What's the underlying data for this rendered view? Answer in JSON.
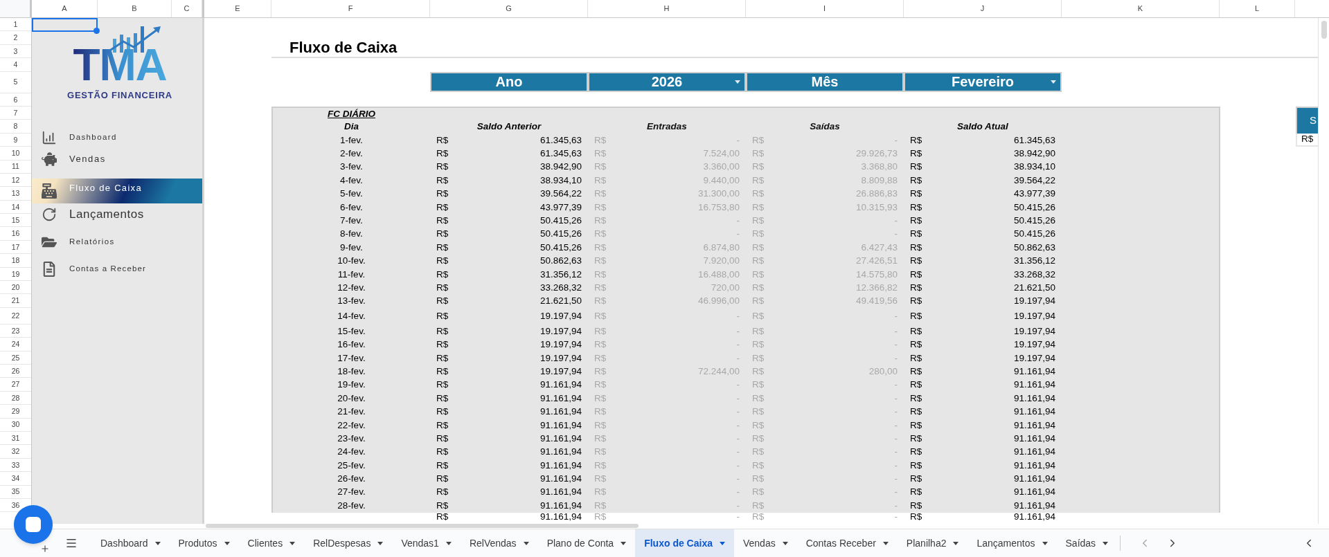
{
  "sheet": {
    "column_headers": [
      "A",
      "B",
      "C",
      "E",
      "F",
      "G",
      "H",
      "I",
      "J",
      "K",
      "L"
    ],
    "row_numbers": [
      "1",
      "2",
      "3",
      "4",
      "5",
      "6",
      "7",
      "8",
      "9",
      "10",
      "11",
      "12",
      "13",
      "14",
      "15",
      "16",
      "17",
      "18",
      "19",
      "20",
      "21",
      "22",
      "23",
      "24",
      "25",
      "26",
      "27",
      "28",
      "29",
      "30",
      "31",
      "32",
      "33",
      "34",
      "35",
      "36"
    ]
  },
  "sidebar": {
    "logo": {
      "mark": "TMA",
      "tagline": "GESTÃO FINANCEIRA"
    },
    "items": [
      {
        "label": "Dashboard",
        "kind": "chart",
        "selected": false
      },
      {
        "label": "Vendas",
        "kind": "piggy",
        "selected": false
      },
      {
        "label": "Fluxo de Caixa",
        "kind": "register",
        "selected": true
      },
      {
        "label": "Lançamentos",
        "kind": "redo",
        "selected": false
      },
      {
        "label": "Relatórios",
        "kind": "folder",
        "selected": false
      },
      {
        "label": "Contas a Receber",
        "kind": "document",
        "selected": false
      }
    ]
  },
  "title": "Fluxo de Caixa",
  "filters": [
    {
      "label": "Ano",
      "value": "2026"
    },
    {
      "label": "Mês",
      "value": "Fevereiro"
    }
  ],
  "cash_flow": {
    "title": "FC DIÁRIO",
    "columns": [
      {
        "label": "Dia",
        "muted": false
      },
      {
        "label": "Saldo Anterior",
        "muted": false
      },
      {
        "label": "Entradas",
        "muted": true
      },
      {
        "label": "Saídas",
        "muted": true
      },
      {
        "label": "Saldo Atual",
        "muted": false
      }
    ],
    "rows": [
      {
        "cells": [
          "1-fev.",
          [
            "R$",
            "61.345,63"
          ],
          [
            "R$",
            "-"
          ],
          [
            "R$",
            "-"
          ],
          [
            "R$",
            "61.345,63"
          ]
        ]
      },
      {
        "cells": [
          "2-fev.",
          [
            "R$",
            "61.345,63"
          ],
          [
            "R$",
            "7.524,00"
          ],
          [
            "R$",
            "29.926,73"
          ],
          [
            "R$",
            "38.942,90"
          ]
        ]
      },
      {
        "cells": [
          "3-fev.",
          [
            "R$",
            "38.942,90"
          ],
          [
            "R$",
            "3.360,00"
          ],
          [
            "R$",
            "3.368,80"
          ],
          [
            "R$",
            "38.934,10"
          ]
        ]
      },
      {
        "cells": [
          "4-fev.",
          [
            "R$",
            "38.934,10"
          ],
          [
            "R$",
            "9.440,00"
          ],
          [
            "R$",
            "8.809,88"
          ],
          [
            "R$",
            "39.564,22"
          ]
        ]
      },
      {
        "cells": [
          "5-fev.",
          [
            "R$",
            "39.564,22"
          ],
          [
            "R$",
            "31.300,00"
          ],
          [
            "R$",
            "26.886,83"
          ],
          [
            "R$",
            "43.977,39"
          ]
        ]
      },
      {
        "cells": [
          "6-fev.",
          [
            "R$",
            "43.977,39"
          ],
          [
            "R$",
            "16.753,80"
          ],
          [
            "R$",
            "10.315,93"
          ],
          [
            "R$",
            "50.415,26"
          ]
        ]
      },
      {
        "cells": [
          "7-fev.",
          [
            "R$",
            "50.415,26"
          ],
          [
            "R$",
            "-"
          ],
          [
            "R$",
            "-"
          ],
          [
            "R$",
            "50.415,26"
          ]
        ]
      },
      {
        "cells": [
          "8-fev.",
          [
            "R$",
            "50.415,26"
          ],
          [
            "R$",
            "-"
          ],
          [
            "R$",
            "-"
          ],
          [
            "R$",
            "50.415,26"
          ]
        ]
      },
      {
        "cells": [
          "9-fev.",
          [
            "R$",
            "50.415,26"
          ],
          [
            "R$",
            "6.874,80"
          ],
          [
            "R$",
            "6.427,43"
          ],
          [
            "R$",
            "50.862,63"
          ]
        ]
      },
      {
        "cells": [
          "10-fev.",
          [
            "R$",
            "50.862,63"
          ],
          [
            "R$",
            "7.920,00"
          ],
          [
            "R$",
            "27.426,51"
          ],
          [
            "R$",
            "31.356,12"
          ]
        ]
      },
      {
        "cells": [
          "11-fev.",
          [
            "R$",
            "31.356,12"
          ],
          [
            "R$",
            "16.488,00"
          ],
          [
            "R$",
            "14.575,80"
          ],
          [
            "R$",
            "33.268,32"
          ]
        ]
      },
      {
        "cells": [
          "12-fev.",
          [
            "R$",
            "33.268,32"
          ],
          [
            "R$",
            "720,00"
          ],
          [
            "R$",
            "12.366,82"
          ],
          [
            "R$",
            "21.621,50"
          ]
        ]
      },
      {
        "cells": [
          "13-fev.",
          [
            "R$",
            "21.621,50"
          ],
          [
            "R$",
            "46.996,00"
          ],
          [
            "R$",
            "49.419,56"
          ],
          [
            "R$",
            "19.197,94"
          ]
        ]
      },
      {
        "cells": [
          "14-fev.",
          [
            "R$",
            "19.197,94"
          ],
          [
            "R$",
            "-"
          ],
          [
            "R$",
            "-"
          ],
          [
            "R$",
            "19.197,94"
          ]
        ]
      },
      {
        "cells": [
          "15-fev.",
          [
            "R$",
            "19.197,94"
          ],
          [
            "R$",
            "-"
          ],
          [
            "R$",
            "-"
          ],
          [
            "R$",
            "19.197,94"
          ]
        ]
      },
      {
        "cells": [
          "16-fev.",
          [
            "R$",
            "19.197,94"
          ],
          [
            "R$",
            "-"
          ],
          [
            "R$",
            "-"
          ],
          [
            "R$",
            "19.197,94"
          ]
        ]
      },
      {
        "cells": [
          "17-fev.",
          [
            "R$",
            "19.197,94"
          ],
          [
            "R$",
            "-"
          ],
          [
            "R$",
            "-"
          ],
          [
            "R$",
            "19.197,94"
          ]
        ]
      },
      {
        "cells": [
          "18-fev.",
          [
            "R$",
            "19.197,94"
          ],
          [
            "R$",
            "72.244,00"
          ],
          [
            "R$",
            "280,00"
          ],
          [
            "R$",
            "91.161,94"
          ]
        ]
      },
      {
        "cells": [
          "19-fev.",
          [
            "R$",
            "91.161,94"
          ],
          [
            "R$",
            "-"
          ],
          [
            "R$",
            "-"
          ],
          [
            "R$",
            "91.161,94"
          ]
        ]
      },
      {
        "cells": [
          "20-fev.",
          [
            "R$",
            "91.161,94"
          ],
          [
            "R$",
            "-"
          ],
          [
            "R$",
            "-"
          ],
          [
            "R$",
            "91.161,94"
          ]
        ]
      },
      {
        "cells": [
          "21-fev.",
          [
            "R$",
            "91.161,94"
          ],
          [
            "R$",
            "-"
          ],
          [
            "R$",
            "-"
          ],
          [
            "R$",
            "91.161,94"
          ]
        ]
      },
      {
        "cells": [
          "22-fev.",
          [
            "R$",
            "91.161,94"
          ],
          [
            "R$",
            "-"
          ],
          [
            "R$",
            "-"
          ],
          [
            "R$",
            "91.161,94"
          ]
        ]
      },
      {
        "cells": [
          "23-fev.",
          [
            "R$",
            "91.161,94"
          ],
          [
            "R$",
            "-"
          ],
          [
            "R$",
            "-"
          ],
          [
            "R$",
            "91.161,94"
          ]
        ]
      },
      {
        "cells": [
          "24-fev.",
          [
            "R$",
            "91.161,94"
          ],
          [
            "R$",
            "-"
          ],
          [
            "R$",
            "-"
          ],
          [
            "R$",
            "91.161,94"
          ]
        ]
      },
      {
        "cells": [
          "25-fev.",
          [
            "R$",
            "91.161,94"
          ],
          [
            "R$",
            "-"
          ],
          [
            "R$",
            "-"
          ],
          [
            "R$",
            "91.161,94"
          ]
        ]
      },
      {
        "cells": [
          "26-fev.",
          [
            "R$",
            "91.161,94"
          ],
          [
            "R$",
            "-"
          ],
          [
            "R$",
            "-"
          ],
          [
            "R$",
            "91.161,94"
          ]
        ]
      },
      {
        "cells": [
          "27-fev.",
          [
            "R$",
            "91.161,94"
          ],
          [
            "R$",
            "-"
          ],
          [
            "R$",
            "-"
          ],
          [
            "R$",
            "91.161,94"
          ]
        ]
      },
      {
        "cells": [
          "28-fev.",
          [
            "R$",
            "91.161,94"
          ],
          [
            "R$",
            "-"
          ],
          [
            "R$",
            "-"
          ],
          [
            "R$",
            "91.161,94"
          ]
        ]
      },
      {
        "cells": [
          "",
          [
            "R$",
            "91.161,94"
          ],
          [
            "R$",
            "-"
          ],
          [
            "R$",
            "-"
          ],
          [
            "R$",
            "91.161,94"
          ]
        ]
      }
    ]
  },
  "side_panel": {
    "header": "S",
    "cell": "R$"
  },
  "sheet_tabs": [
    {
      "label": "Dashboard",
      "selected": false
    },
    {
      "label": "Produtos",
      "selected": false
    },
    {
      "label": "Clientes",
      "selected": false
    },
    {
      "label": "RelDespesas",
      "selected": false
    },
    {
      "label": "Vendas1",
      "selected": false
    },
    {
      "label": "RelVendas",
      "selected": false
    },
    {
      "label": "Plano de Conta",
      "selected": false
    },
    {
      "label": "Fluxo de Caixa",
      "selected": true
    },
    {
      "label": "Vendas",
      "selected": false
    },
    {
      "label": "Contas Receber",
      "selected": false
    },
    {
      "label": "Planilha2",
      "selected": false
    },
    {
      "label": "Lançamentos",
      "selected": false
    },
    {
      "label": "Saídas",
      "selected": false
    }
  ]
}
